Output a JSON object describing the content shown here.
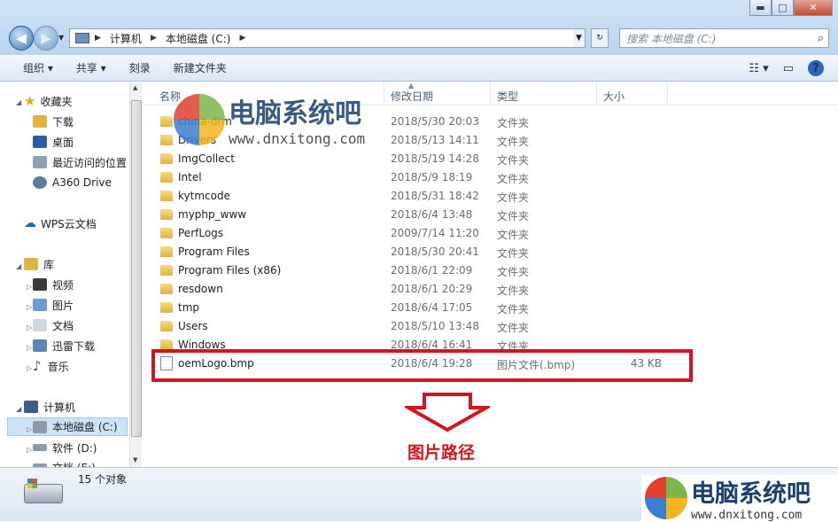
{
  "window": {
    "min_label": "▬",
    "max_label": "□",
    "close_label": "✕"
  },
  "nav_buttons": {
    "back": "◀",
    "forward": "▶"
  },
  "address": {
    "root": "计算机",
    "drive": "本地磁盘 (C:)"
  },
  "search": {
    "placeholder": "搜索 本地磁盘 (C:)"
  },
  "toolbar": {
    "organize": "组织 ▾",
    "share": "共享 ▾",
    "burn": "刻录",
    "new_folder": "新建文件夹"
  },
  "sidebar": {
    "favorites": "收藏夹",
    "downloads": "下载",
    "desktop": "桌面",
    "recent": "最近访问的位置",
    "a360": "A360 Drive",
    "wps": "WPS云文档",
    "library": "库",
    "videos": "视频",
    "pictures": "图片",
    "documents": "文档",
    "xunlei": "迅雷下载",
    "music": "音乐",
    "computer": "计算机",
    "local_c": "本地磁盘 (C:)",
    "soft_d": "软件 (D:)",
    "doc_e": "文档 (E:)"
  },
  "columns": {
    "name": "名称",
    "date": "修改日期",
    "type": "类型",
    "size": "大小"
  },
  "files": [
    {
      "name": "china-drm",
      "date": "2018/5/30 20:03",
      "type": "文件夹",
      "size": ""
    },
    {
      "name": "Drivers",
      "date": "2018/5/13 14:11",
      "type": "文件夹",
      "size": ""
    },
    {
      "name": "ImgCollect",
      "date": "2018/5/19 14:28",
      "type": "文件夹",
      "size": ""
    },
    {
      "name": "Intel",
      "date": "2018/5/9 18:19",
      "type": "文件夹",
      "size": ""
    },
    {
      "name": "kytmcode",
      "date": "2018/5/31 18:42",
      "type": "文件夹",
      "size": ""
    },
    {
      "name": "myphp_www",
      "date": "2018/6/4 13:48",
      "type": "文件夹",
      "size": ""
    },
    {
      "name": "PerfLogs",
      "date": "2009/7/14 11:20",
      "type": "文件夹",
      "size": ""
    },
    {
      "name": "Program Files",
      "date": "2018/5/30 20:41",
      "type": "文件夹",
      "size": ""
    },
    {
      "name": "Program Files (x86)",
      "date": "2018/6/1 22:09",
      "type": "文件夹",
      "size": ""
    },
    {
      "name": "resdown",
      "date": "2018/6/1 20:29",
      "type": "文件夹",
      "size": ""
    },
    {
      "name": "tmp",
      "date": "2018/6/4 17:05",
      "type": "文件夹",
      "size": ""
    },
    {
      "name": "Users",
      "date": "2018/5/10 13:48",
      "type": "文件夹",
      "size": ""
    },
    {
      "name": "Windows",
      "date": "2018/6/4 16:41",
      "type": "文件夹",
      "size": ""
    },
    {
      "name": "oemLogo.bmp",
      "date": "2018/6/4 19:28",
      "type": "图片文件(.bmp)",
      "size": "43 KB"
    }
  ],
  "annotation": {
    "caption": "图片路径"
  },
  "status": {
    "count": "15 个对象"
  },
  "watermark": {
    "title": "电脑系统吧",
    "url": "www.dnxitong.com"
  },
  "colors": {
    "highlight": "#d3161d"
  }
}
